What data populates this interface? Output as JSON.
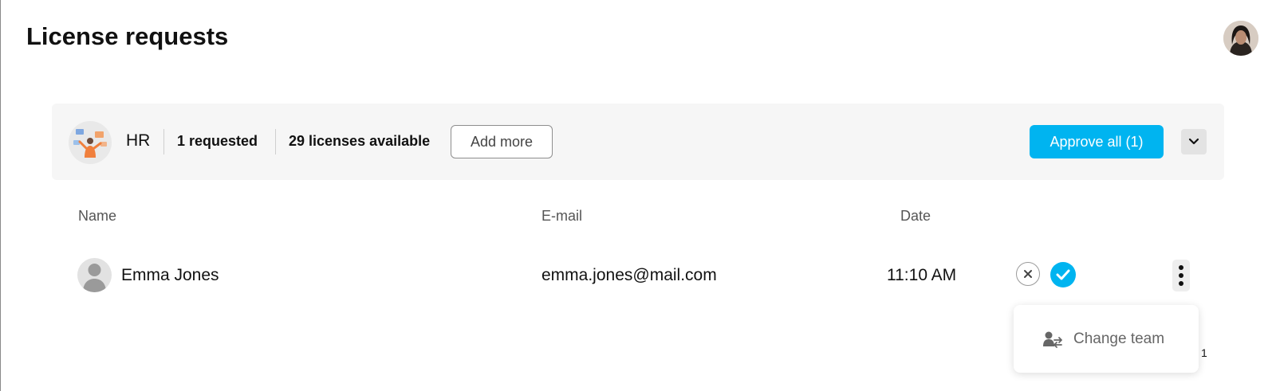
{
  "header": {
    "title": "License requests"
  },
  "team": {
    "name": "HR",
    "requested": "1 requested",
    "available": "29 licenses available",
    "add_more_label": "Add more",
    "approve_all_label": "Approve all (1)"
  },
  "table": {
    "columns": [
      "Name",
      "E-mail",
      "Date"
    ],
    "rows": [
      {
        "name": "Emma Jones",
        "email": "emma.jones@mail.com",
        "date": "11:10 AM"
      }
    ]
  },
  "menu": {
    "items": [
      {
        "label": "Change team",
        "icon": "change-team-icon"
      }
    ]
  },
  "footer": {
    "count": "1"
  },
  "colors": {
    "accent": "#00b4f0",
    "bar_bg": "#f6f6f6"
  }
}
